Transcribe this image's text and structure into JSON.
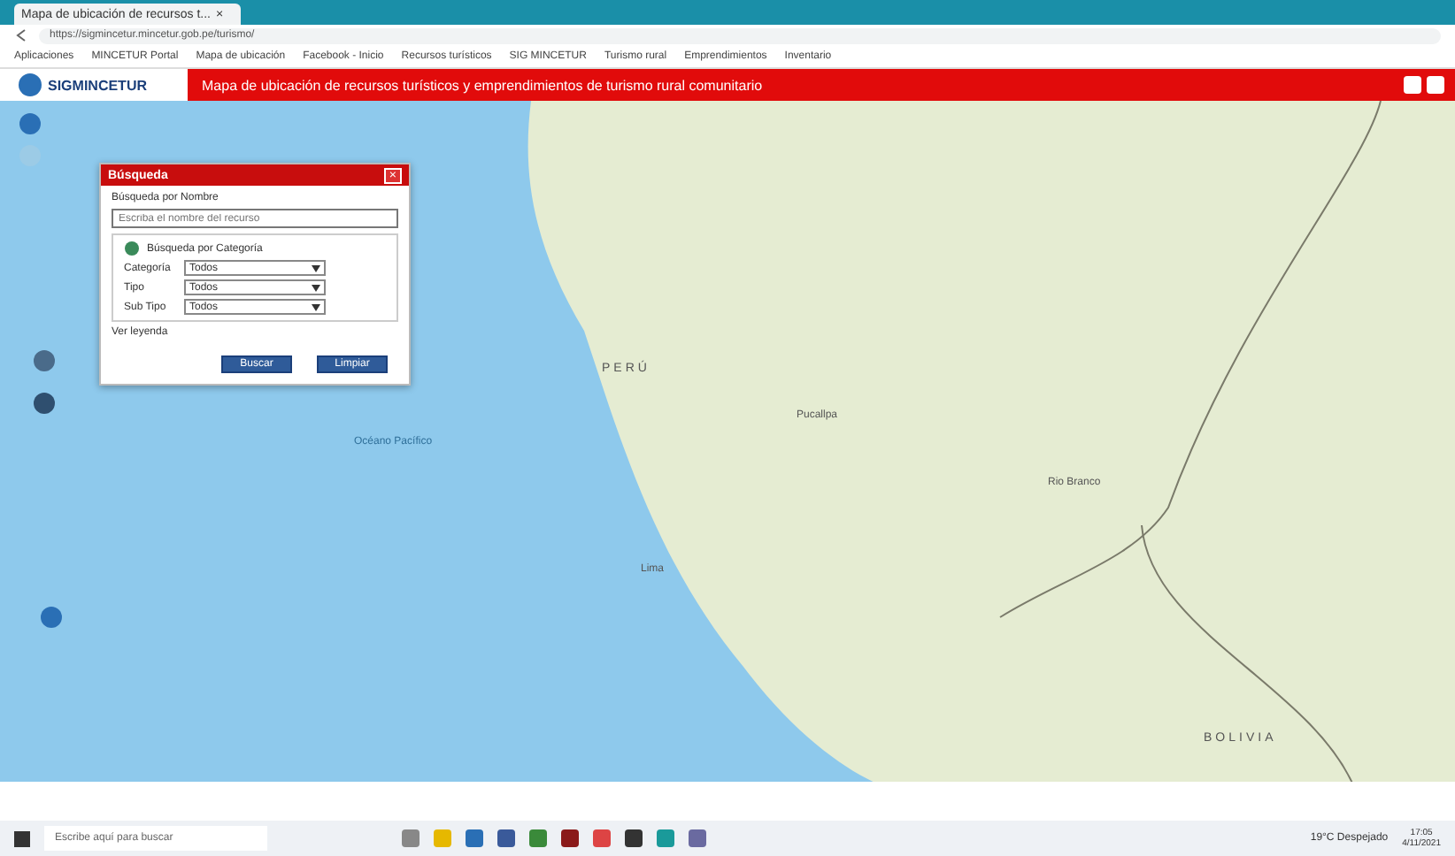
{
  "browser": {
    "tab_title": "Mapa de ubicación de recursos t...",
    "close": "×",
    "url": "https://sigmincetur.mincetur.gob.pe/turismo/"
  },
  "bookmarks": [
    "Aplicaciones",
    "MINCETUR Portal",
    "Mapa de ubicación",
    "Facebook - Inicio",
    "Recursos turísticos",
    "SIG MINCETUR",
    "Turismo rural",
    "Emprendimientos",
    "Inventario"
  ],
  "header": {
    "logo": "SIGMINCETUR",
    "title": "Mapa de ubicación de recursos turísticos y emprendimientos de turismo rural comunitario"
  },
  "dialog": {
    "title": "Búsqueda",
    "close": "×",
    "name_label": "Búsqueda por Nombre",
    "name_placeholder": "Escriba el nombre del recurso",
    "category_section": "Búsqueda por Categoría",
    "filters": [
      {
        "label": "Categoría",
        "value": "Todos"
      },
      {
        "label": "Tipo",
        "value": "Todos"
      },
      {
        "label": "Sub Tipo",
        "value": "Todos"
      }
    ],
    "help": "Ver leyenda",
    "buttons": [
      "Buscar",
      "Limpiar"
    ]
  },
  "map_labels": [
    {
      "text": "PERÚ",
      "kind": "country"
    },
    {
      "text": "Lima",
      "kind": "city"
    },
    {
      "text": "Pucallpa",
      "kind": "city"
    },
    {
      "text": "Rio Branco",
      "kind": "city"
    },
    {
      "text": "BOLIVIA",
      "kind": "country"
    },
    {
      "text": "Océano Pacífico",
      "kind": "sea"
    }
  ],
  "taskbar": {
    "search_placeholder": "Escribe aquí para buscar",
    "weather": "19°C Despejado",
    "time": "17:05",
    "date": "4/11/2021"
  }
}
